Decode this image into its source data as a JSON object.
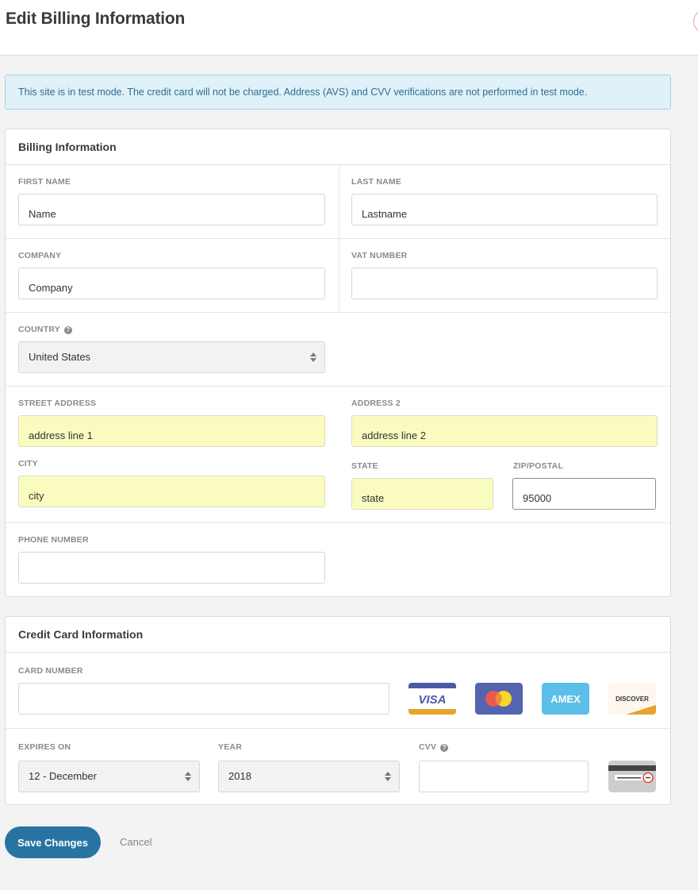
{
  "header": {
    "title": "Edit Billing Information"
  },
  "alert": {
    "text": "This site is in test mode. The credit card will not be charged. Address (AVS) and CVV verifications are not performed in test mode."
  },
  "billing": {
    "title": "Billing Information",
    "first_name": {
      "label": "FIRST NAME",
      "value": "Name"
    },
    "last_name": {
      "label": "LAST NAME",
      "value": "Lastname"
    },
    "company": {
      "label": "COMPANY",
      "value": "Company"
    },
    "vat_number": {
      "label": "VAT NUMBER",
      "value": ""
    },
    "country": {
      "label": "COUNTRY",
      "value": "United States",
      "help_icon": "question-circle-icon"
    },
    "street_address": {
      "label": "STREET ADDRESS",
      "value": "address line 1"
    },
    "address2": {
      "label": "ADDRESS 2",
      "value": "address line 2"
    },
    "city": {
      "label": "CITY",
      "value": "city"
    },
    "state": {
      "label": "STATE",
      "value": "state"
    },
    "zip": {
      "label": "ZIP/POSTAL",
      "value": "95000"
    },
    "phone": {
      "label": "PHONE NUMBER",
      "value": ""
    }
  },
  "credit_card": {
    "title": "Credit Card Information",
    "card_number": {
      "label": "CARD NUMBER",
      "value": ""
    },
    "card_brands": [
      {
        "name": "VISA",
        "colors": {
          "top": "#4c5aa6",
          "bottom": "#e6a42a",
          "text": "#4c5aa6"
        }
      },
      {
        "name": "Mastercard",
        "colors": {
          "bg": "#5464ae",
          "left": "#e95a4d",
          "right": "#f5d62a"
        }
      },
      {
        "name": "AMEX",
        "colors": {
          "bg": "#5bbfe9",
          "text": "#ffffff"
        }
      },
      {
        "name": "DISCOVER",
        "colors": {
          "bg": "#fdf7ee",
          "accent": "#e6a42a",
          "text": "#333333"
        }
      }
    ],
    "expires_on": {
      "label": "EXPIRES ON",
      "value": "12 - December"
    },
    "year": {
      "label": "YEAR",
      "value": "2018"
    },
    "cvv": {
      "label": "CVV",
      "value": "",
      "help_icon": "question-circle-icon"
    }
  },
  "actions": {
    "save_label": "Save Changes",
    "cancel_label": "Cancel"
  },
  "colors": {
    "primary": "#2774a3",
    "alert_bg": "#e1f1f9",
    "alert_text": "#2b6e94",
    "autofill": "#fafcbf"
  }
}
